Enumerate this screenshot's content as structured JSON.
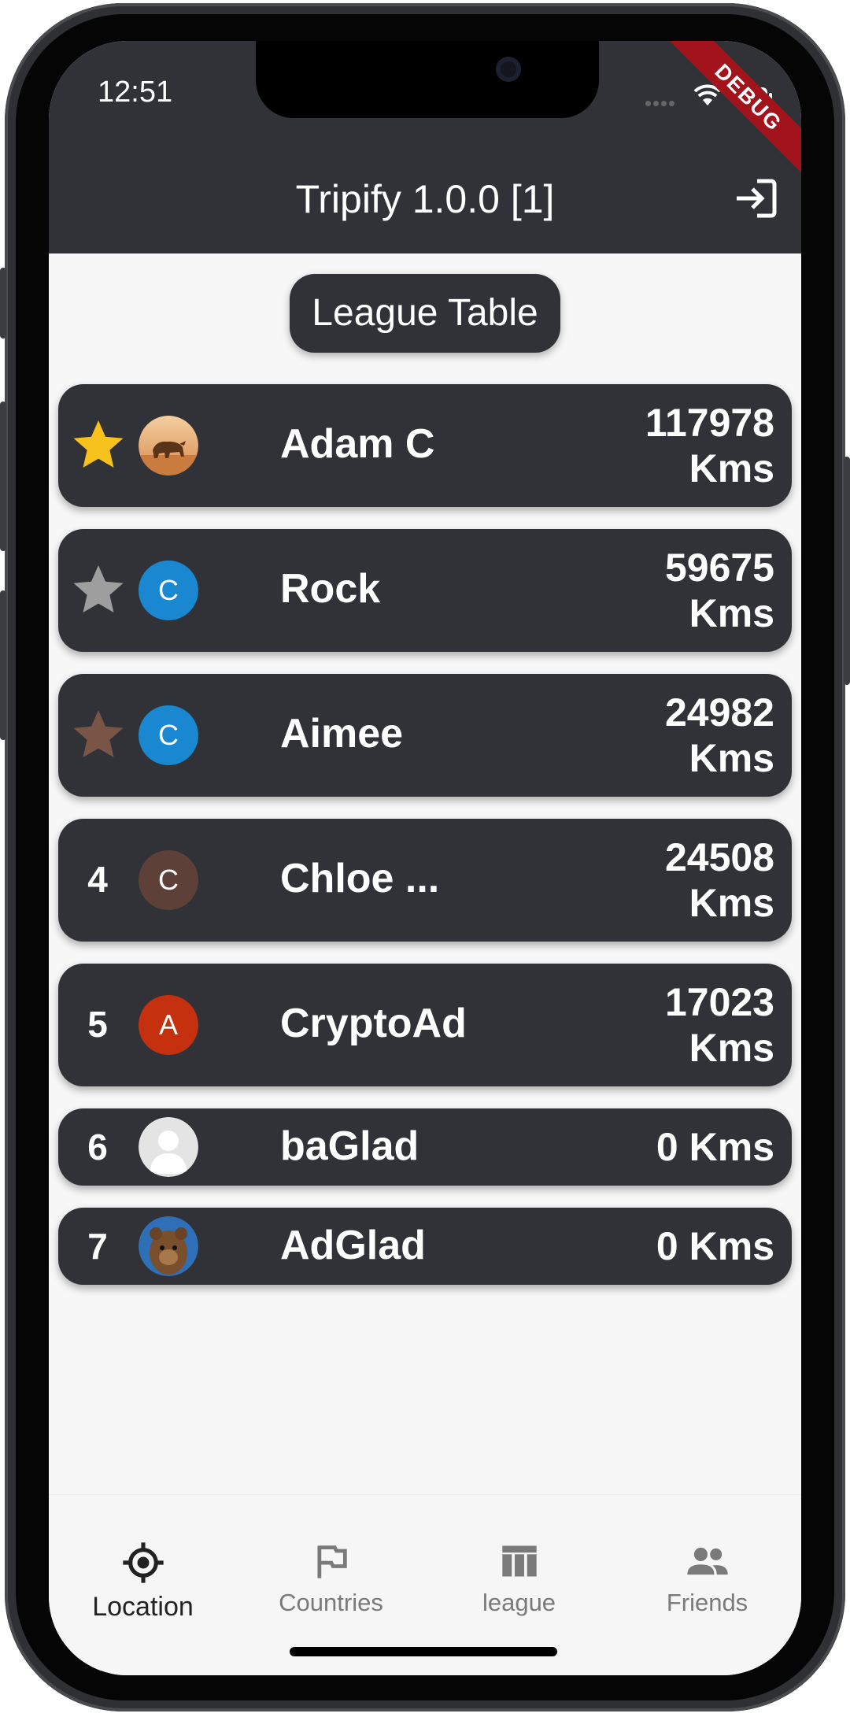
{
  "status_bar": {
    "time": "12:51",
    "debug_banner": "DEBUG"
  },
  "appbar": {
    "title": "Tripify 1.0.0 [1]",
    "action_icon": "logout-icon"
  },
  "league": {
    "title": "League Table",
    "rows": [
      {
        "rank": "1",
        "badge": "gold-star",
        "avatar": "image",
        "name": "Adam C",
        "distance": "117978",
        "unit": "Kms"
      },
      {
        "rank": "2",
        "badge": "silver-star",
        "avatar_letter": "C",
        "name": "Rock",
        "distance": "59675",
        "unit": "Kms"
      },
      {
        "rank": "3",
        "badge": "bronze-star",
        "avatar_letter": "C",
        "name": "Aimee",
        "distance": "24982",
        "unit": "Kms"
      },
      {
        "rank": "4",
        "avatar_letter": "C",
        "name": "Chloe ...",
        "distance": "24508",
        "unit": "Kms"
      },
      {
        "rank": "5",
        "avatar_letter": "A",
        "name": "CryptoAd",
        "distance": "17023",
        "unit": "Kms"
      },
      {
        "rank": "6",
        "avatar": "placeholder",
        "name": "baGlad",
        "distance_full": "0 Kms"
      },
      {
        "rank": "7",
        "avatar": "image",
        "name": "AdGlad",
        "distance_full": "0 Kms"
      }
    ]
  },
  "nav": {
    "items": [
      {
        "label": "Location",
        "icon": "location-crosshair-icon",
        "active": true
      },
      {
        "label": "Countries",
        "icon": "flag-icon",
        "active": false
      },
      {
        "label": "league",
        "icon": "table-icon",
        "active": false
      },
      {
        "label": "Friends",
        "icon": "people-icon",
        "active": false
      }
    ]
  },
  "colors": {
    "bar": "#303238",
    "background": "#f7f7f7",
    "gold": "#f7c21b",
    "silver": "#9e9e9e",
    "bronze": "#795548",
    "avatar_blue": "#1a88d0",
    "avatar_brown": "#5d4037",
    "avatar_red": "#c5310f",
    "debug_red": "#a3131c"
  }
}
